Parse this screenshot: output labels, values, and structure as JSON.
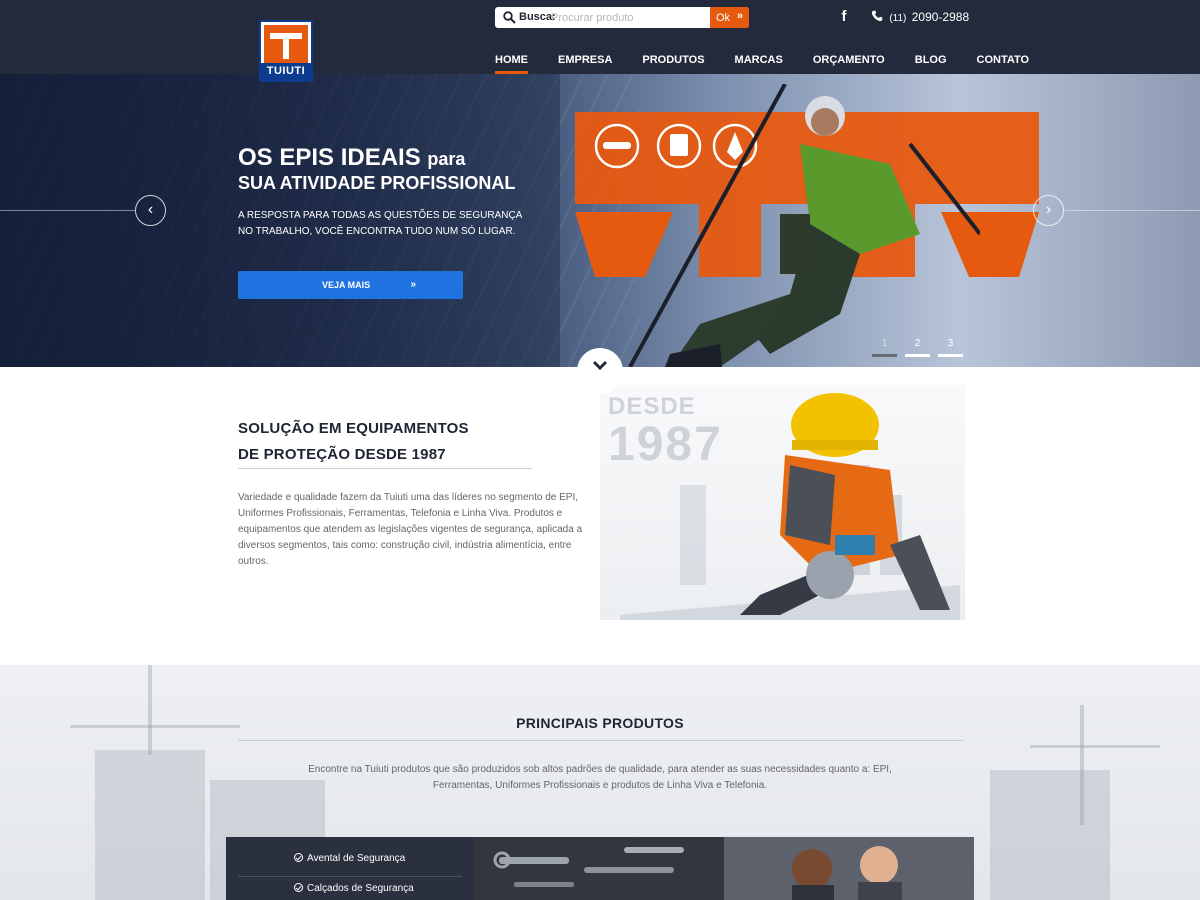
{
  "header": {
    "logo_text": "TUIUTI",
    "search": {
      "label": "Busca:",
      "placeholder": "Procurar produto",
      "button_label": "Ok"
    },
    "phone": {
      "ddd": "(11)",
      "number": "2090-2988"
    },
    "nav": [
      "HOME",
      "EMPRESA",
      "PRODUTOS",
      "MARCAS",
      "ORÇAMENTO",
      "BLOG",
      "CONTATO"
    ],
    "active_nav": "HOME"
  },
  "hero": {
    "title_main": "OS EPIS IDEAIS",
    "title_small": "para",
    "title_line2": "SUA ATIVIDADE PROFISSIONAL",
    "text": "A RESPOSTA PARA TODAS AS QUESTÕES DE SEGURANÇA NO TRABALHO, VOCÊ ENCONTRA TUDO NUM SÓ LUGAR.",
    "button_label": "VEJA MAIS",
    "pages": [
      "1",
      "2",
      "3"
    ],
    "active_page": 1
  },
  "about": {
    "title_line1": "SOLUÇÃO EM EQUIPAMENTOS",
    "title_line2": "DE PROTEÇÃO DESDE 1987",
    "text": "Variedade e qualidade fazem da Tuiuti uma das líderes no segmento de EPI, Uniformes Profissionais, Ferramentas, Telefonia e Linha Viva. Produtos e equipamentos que atendem as legislações vigentes de segurança, aplicada a diversos segmentos, tais como: construção civil, indústria alimentícia, entre outros.",
    "image_text_1": "DESDE",
    "image_text_2": "1987"
  },
  "products": {
    "title": "PRINCIPAIS PRODUTOS",
    "text": "Encontre na Tuiuti produtos que são produzidos sob altos padrões de qualidade, para atender as suas necessidades quanto a: EPI, Ferramentas, Uniformes Profissionais e produtos de Linha Viva e Telefonia.",
    "categories": [
      "Avental de Segurança",
      "Calçados de Segurança"
    ]
  },
  "colors": {
    "navy": "#232a3c",
    "orange": "#e65a10",
    "blue": "#1f73e0"
  }
}
